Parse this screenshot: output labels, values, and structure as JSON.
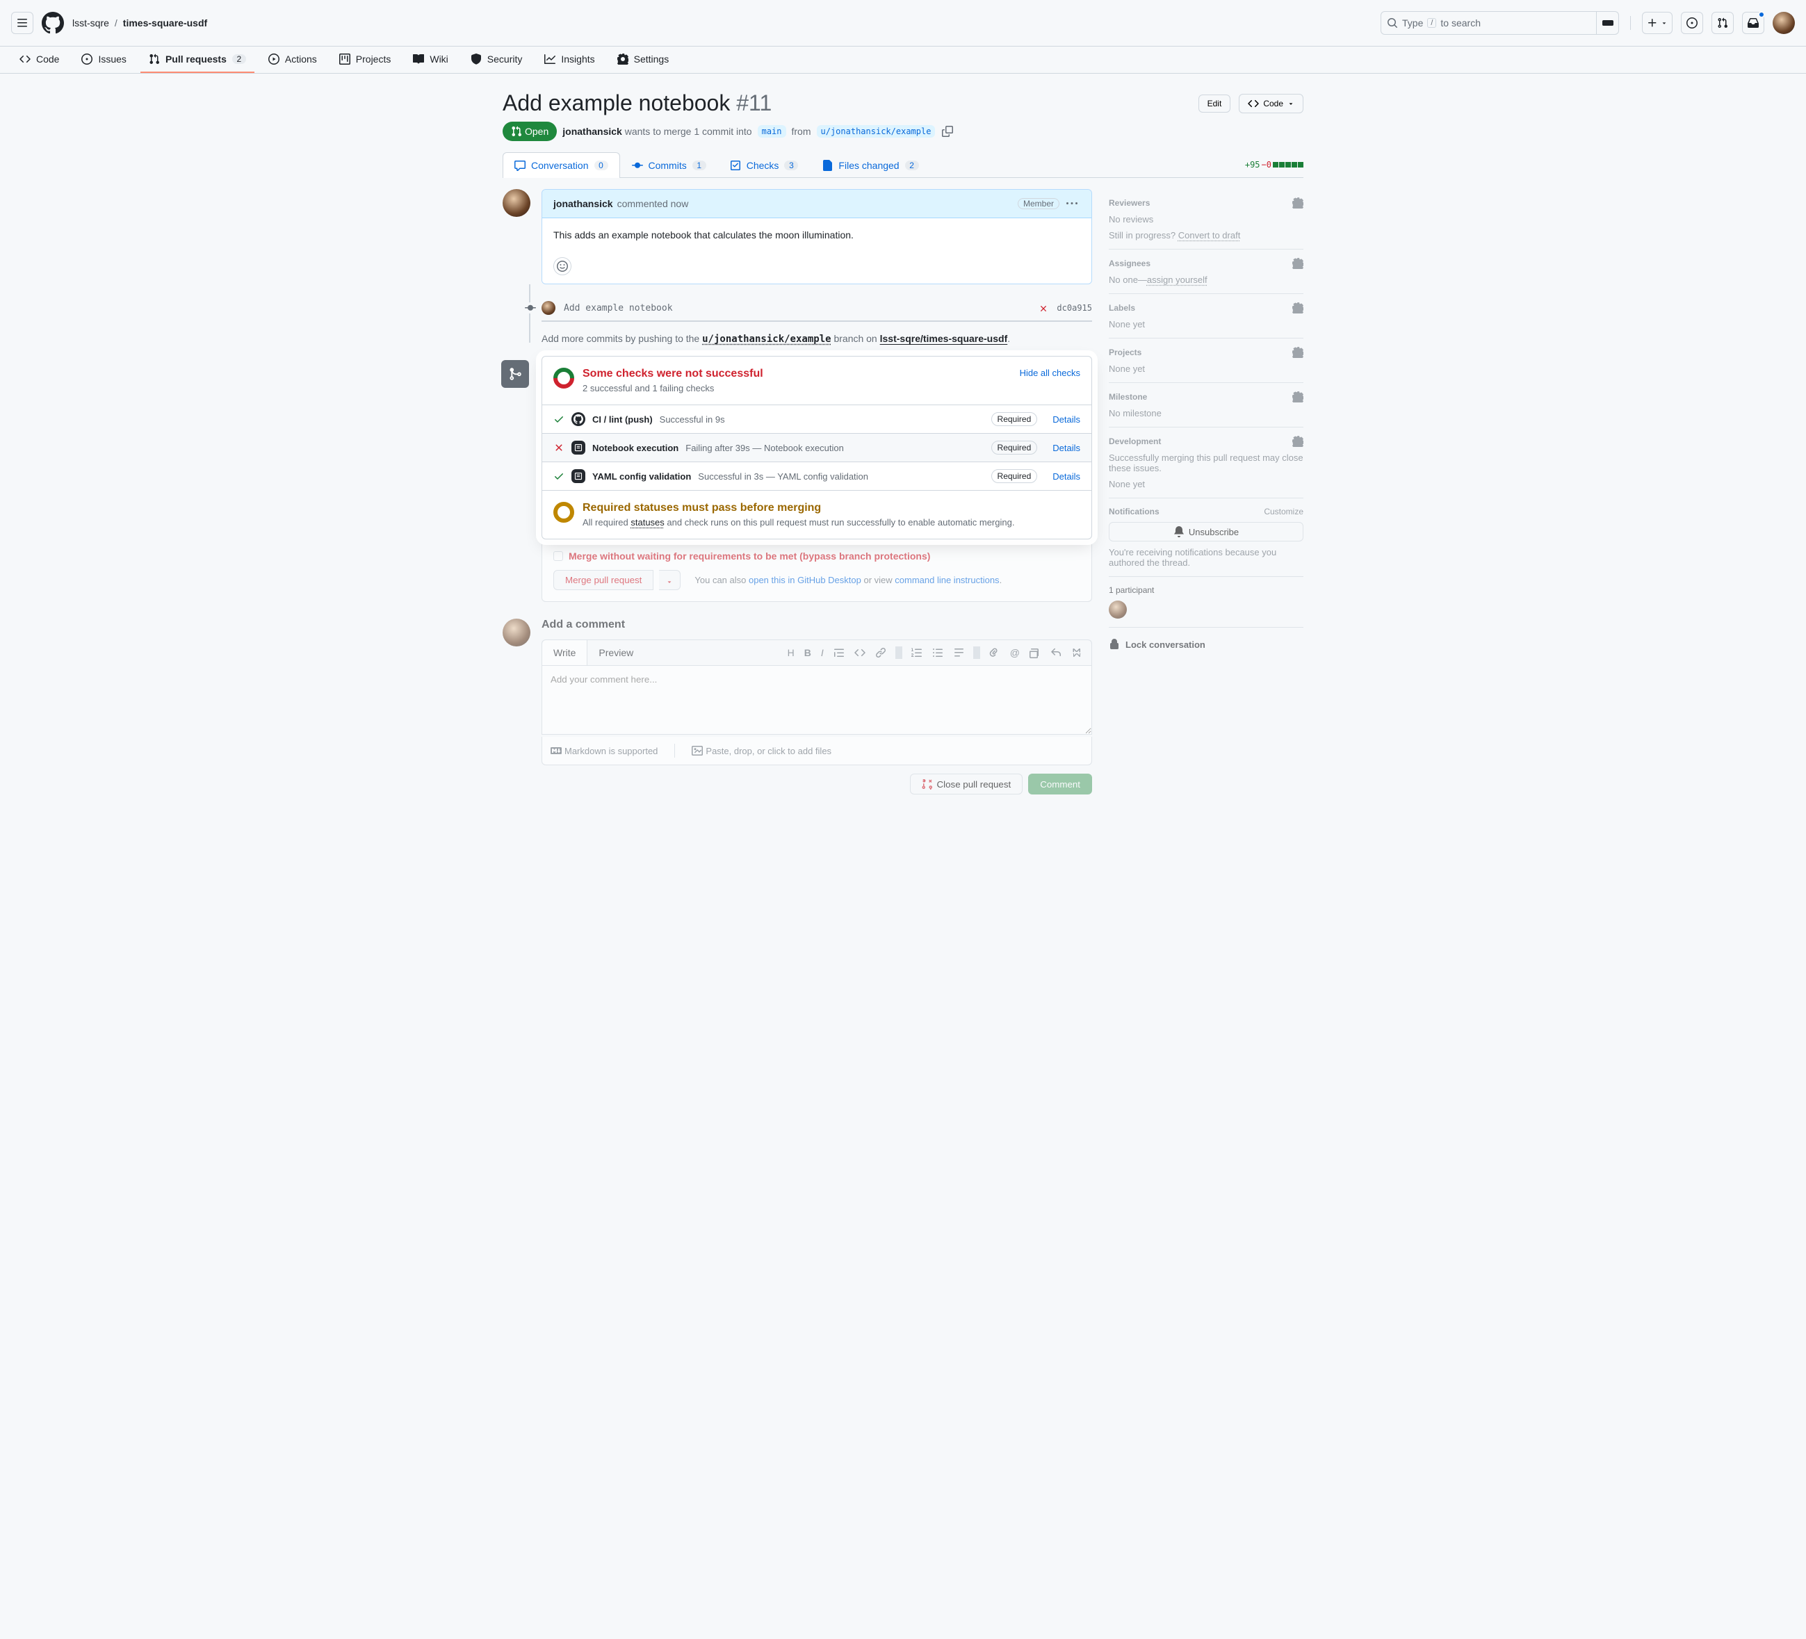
{
  "header": {
    "org": "lsst-sqre",
    "repo": "times-square-usdf",
    "search_placeholder": "Type",
    "search_suffix": "to search"
  },
  "nav": {
    "code": "Code",
    "issues": "Issues",
    "pulls": "Pull requests",
    "pulls_count": "2",
    "actions": "Actions",
    "projects": "Projects",
    "wiki": "Wiki",
    "security": "Security",
    "insights": "Insights",
    "settings": "Settings"
  },
  "pr": {
    "title": "Add example notebook",
    "number": "#11",
    "edit": "Edit",
    "code": "Code",
    "state": "Open",
    "author": "jonathansick",
    "wants": "wants to merge 1 commit into",
    "base": "main",
    "from": "from",
    "head": "u/jonathansick/example"
  },
  "tabs": {
    "conversation": "Conversation",
    "conversation_count": "0",
    "commits": "Commits",
    "commits_count": "1",
    "checks": "Checks",
    "checks_count": "3",
    "files": "Files changed",
    "files_count": "2",
    "diff_plus": "+95",
    "diff_minus": "−0"
  },
  "comment": {
    "author": "jonathansick",
    "time": "commented now",
    "badge": "Member",
    "body": "This adds an example notebook that calculates the moon illumination."
  },
  "commit": {
    "msg": "Add example notebook",
    "sha": "dc0a915"
  },
  "push_hint": {
    "prefix": "Add more commits by pushing to the",
    "branch": "u/jonathansick/example",
    "mid": "branch on",
    "repo": "lsst-sqre/times-square-usdf"
  },
  "merge": {
    "fail_title": "Some checks were not successful",
    "fail_sub": "2 successful and 1 failing checks",
    "hide": "Hide all checks",
    "checks": [
      {
        "ok": true,
        "app": "gh",
        "name": "CI / lint (push)",
        "status": "Successful in 9s",
        "required": "Required",
        "details": "Details"
      },
      {
        "ok": false,
        "app": "sq",
        "name": "Notebook execution",
        "status": "Failing after 39s — Notebook execution",
        "required": "Required",
        "details": "Details"
      },
      {
        "ok": true,
        "app": "sq",
        "name": "YAML config validation",
        "status": "Successful in 3s — YAML config validation",
        "required": "Required",
        "details": "Details"
      }
    ],
    "warn_title": "Required statuses must pass before merging",
    "warn_prefix": "All required ",
    "warn_link": "statuses",
    "warn_suffix": " and check runs on this pull request must run successfully to enable automatic merging.",
    "bypass": "Merge without waiting for requirements to be met (bypass branch protections)",
    "merge_btn": "Merge pull request",
    "help_prefix": "You can also ",
    "help_link1": "open this in GitHub Desktop",
    "help_mid": " or view ",
    "help_link2": "command line instructions"
  },
  "form": {
    "title": "Add a comment",
    "write": "Write",
    "preview": "Preview",
    "placeholder": "Add your comment here...",
    "markdown": "Markdown is supported",
    "paste": "Paste, drop, or click to add files",
    "close": "Close pull request",
    "comment": "Comment"
  },
  "sidebar": {
    "reviewers": {
      "title": "Reviewers",
      "body": "No reviews",
      "progress": "Still in progress? ",
      "convert": "Convert to draft"
    },
    "assignees": {
      "title": "Assignees",
      "body": "No one—",
      "assign": "assign yourself"
    },
    "labels": {
      "title": "Labels",
      "body": "None yet"
    },
    "projects": {
      "title": "Projects",
      "body": "None yet"
    },
    "milestone": {
      "title": "Milestone",
      "body": "No milestone"
    },
    "development": {
      "title": "Development",
      "body": "Successfully merging this pull request may close these issues.",
      "none": "None yet"
    },
    "notifications": {
      "title": "Notifications",
      "customize": "Customize",
      "unsub": "Unsubscribe",
      "reason": "You're receiving notifications because you authored the thread."
    },
    "participants": {
      "title": "1 participant"
    },
    "lock": "Lock conversation"
  }
}
